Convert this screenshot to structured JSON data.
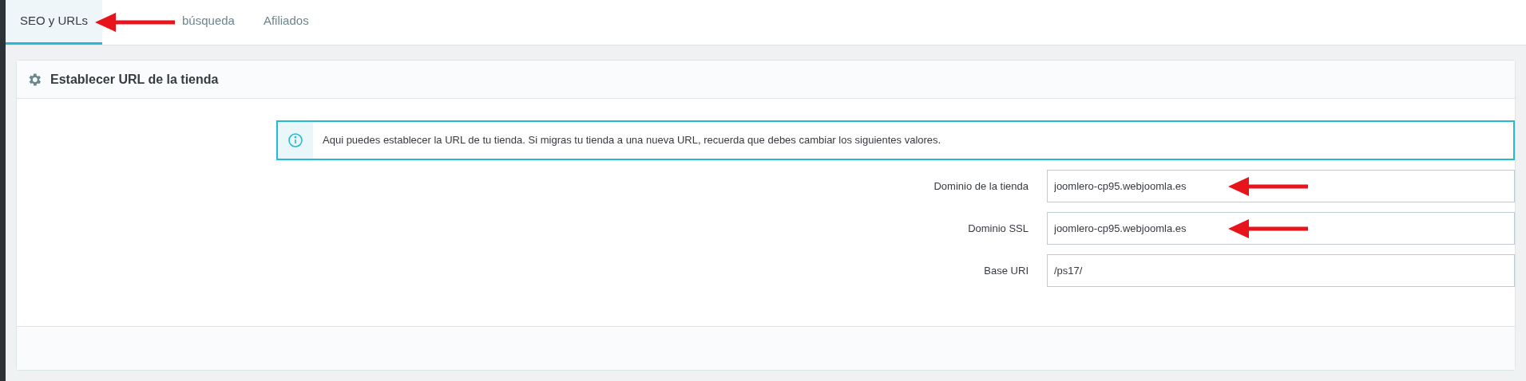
{
  "tabs": [
    {
      "label": "SEO y URLs",
      "selected": true
    },
    {
      "label": "búsqueda",
      "selected": false
    },
    {
      "label": "Afiliados",
      "selected": false
    }
  ],
  "panel": {
    "title": "Establecer URL de la tienda",
    "info": "Aqui puedes establecer la URL de tu tienda. Si migras tu tienda a una nueva URL, recuerda que debes cambiar los siguientes valores.",
    "fields": [
      {
        "label": "Dominio de la tienda",
        "value": "joomlero-cp95.webjoomla.es"
      },
      {
        "label": "Dominio SSL",
        "value": "joomlero-cp95.webjoomla.es"
      },
      {
        "label": "Base URI",
        "value": "/ps17/"
      }
    ]
  }
}
